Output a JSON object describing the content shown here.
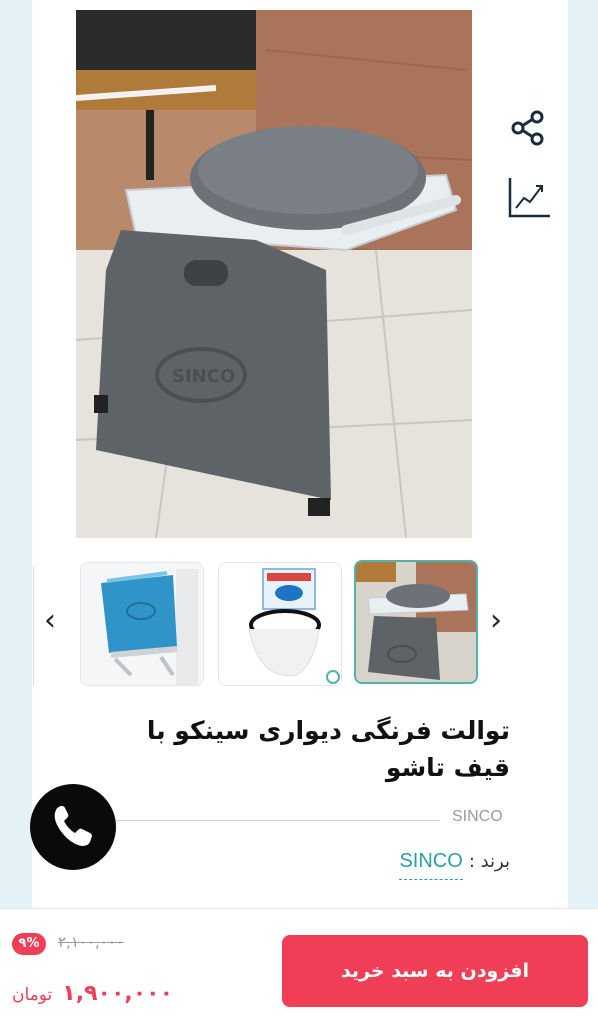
{
  "product": {
    "title": "توالت فرنگی دیواری سینکو با قیف تاشو",
    "brand_en": "SINCO",
    "brand_label": "برند :",
    "brand_link": "SINCO"
  },
  "gallery": {
    "main_image_alt": "SINCO",
    "thumbnails": [
      "thumb-seat",
      "thumb-package",
      "thumb-blue-folded"
    ]
  },
  "actions": {
    "add_to_cart": "افزودن به سبد خرید"
  },
  "pricing": {
    "discount_badge": "۹%",
    "old_price": "۲,۱۰۰,۰۰۰",
    "price": "۱,۹۰۰,۰۰۰",
    "currency": "تومان"
  },
  "colors": {
    "accent": "#ef3e55",
    "link": "#2a9ea8",
    "active_thumb": "#4fb3a8",
    "page_bg": "#e4f1f6"
  },
  "icons": [
    "share-icon",
    "price-chart-icon",
    "chevron-left-icon",
    "chevron-right-icon",
    "phone-icon"
  ]
}
